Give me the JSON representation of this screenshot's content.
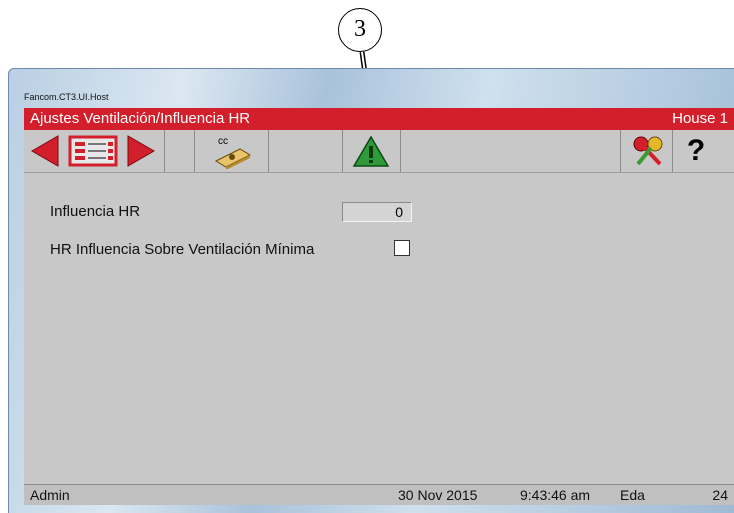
{
  "callout": {
    "number": "3"
  },
  "window": {
    "title": "Fancom.CT3.UI.Host"
  },
  "titlebar": {
    "title": "Ajustes Ventilación/Influencia HR",
    "house": "House 1"
  },
  "toolbar": {
    "cc_label": "cc",
    "help_label": "?"
  },
  "settings": {
    "influence_label": "Influencia HR",
    "influence_value": "0",
    "min_vent_label": "HR Influencia Sobre Ventilación Mínima"
  },
  "status": {
    "user": "Admin",
    "date": "30 Nov 2015",
    "time": "9:43:46 am",
    "mode": "Eda",
    "number": "24"
  }
}
